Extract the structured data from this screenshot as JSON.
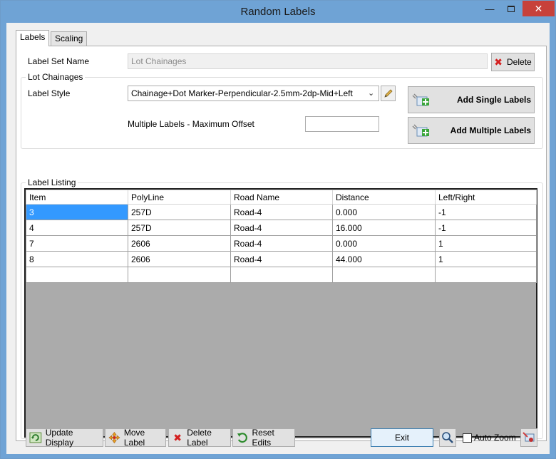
{
  "window": {
    "title": "Random Labels"
  },
  "tabs": {
    "labels": "Labels",
    "scaling": "Scaling"
  },
  "label_set": {
    "label": "Label Set Name",
    "value": "Lot Chainages",
    "delete_label": "Delete"
  },
  "lot_chainages": {
    "title": "Lot Chainages",
    "style_label": "Label Style",
    "style_value": "Chainage+Dot Marker-Perpendicular-2.5mm-2dp-Mid+Left",
    "max_offset_label": "Multiple Labels - Maximum Offset",
    "max_offset_value": "",
    "add_single": "Add Single Labels",
    "add_multiple": "Add Multiple Labels"
  },
  "listing": {
    "title": "Label Listing",
    "columns": [
      "Item",
      "PolyLine",
      "Road Name",
      "Distance",
      "Left/Right"
    ],
    "rows": [
      [
        "3",
        "257D",
        "Road-4",
        "0.000",
        "-1"
      ],
      [
        "4",
        "257D",
        "Road-4",
        "16.000",
        "-1"
      ],
      [
        "7",
        "2606",
        "Road-4",
        "0.000",
        "1"
      ],
      [
        "8",
        "2606",
        "Road-4",
        "44.000",
        "1"
      ]
    ]
  },
  "bottom": {
    "update_display": "Update Display",
    "move_label": "Move Label",
    "delete_label": "Delete Label",
    "reset_edits": "Reset Edits",
    "exit": "Exit",
    "auto_zoom": "Auto Zoom",
    "auto_zoom_checked": false
  },
  "colors": {
    "titlebar": "#6fa3d5",
    "selection": "#3399ff",
    "close": "#c7413a"
  }
}
